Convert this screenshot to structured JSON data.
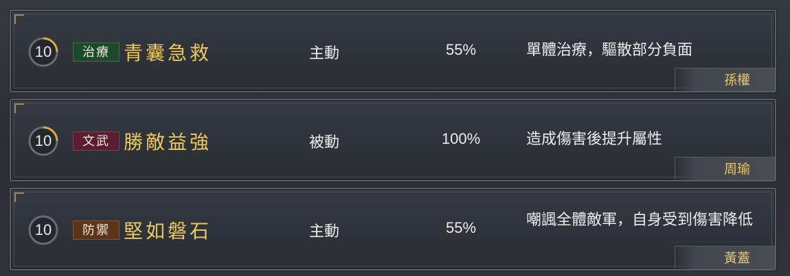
{
  "skills": [
    {
      "level": "10",
      "tag": "治療",
      "tag_color": "#1e4a2c",
      "name": "青囊急救",
      "type": "主動",
      "rate": "55%",
      "description": "單體治療，驅散部分負面",
      "owner": "孫權"
    },
    {
      "level": "10",
      "tag": "文武",
      "tag_color": "#5a1e30",
      "name": "勝敵益強",
      "type": "被動",
      "rate": "100%",
      "description": "造成傷害後提升屬性",
      "owner": "周瑜"
    },
    {
      "level": "10",
      "tag": "防禦",
      "tag_color": "#5e3419",
      "name": "堅如磐石",
      "type": "主動",
      "rate": "55%",
      "description": "嘲諷全體敵軍，自身受到傷害降低",
      "owner": "黃蓋"
    }
  ]
}
